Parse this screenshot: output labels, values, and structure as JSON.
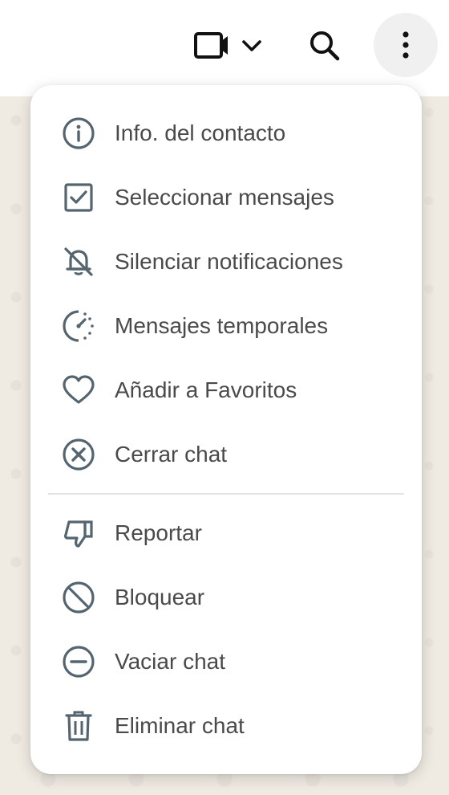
{
  "header": {
    "icons": [
      "video-call-icon",
      "chevron-down-icon",
      "search-icon",
      "more-vertical-icon"
    ]
  },
  "menu": {
    "items": [
      {
        "label": "Info. del contacto",
        "icon": "info-icon"
      },
      {
        "label": "Seleccionar mensajes",
        "icon": "checkbox-icon"
      },
      {
        "label": "Silenciar notificaciones",
        "icon": "bell-off-icon"
      },
      {
        "label": "Mensajes temporales",
        "icon": "timer-icon"
      },
      {
        "label": "Añadir a Favoritos",
        "icon": "heart-icon"
      },
      {
        "label": "Cerrar chat",
        "icon": "close-circle-icon"
      },
      {
        "label": "Reportar",
        "icon": "thumbs-down-icon"
      },
      {
        "label": "Bloquear",
        "icon": "block-icon"
      },
      {
        "label": "Vaciar chat",
        "icon": "minus-circle-icon"
      },
      {
        "label": "Eliminar chat",
        "icon": "trash-icon"
      }
    ]
  },
  "colors": {
    "icon": "#54656f",
    "menu_text": "#4a4a4a",
    "header_icon": "#111111",
    "wallpaper": "#efeae2"
  }
}
